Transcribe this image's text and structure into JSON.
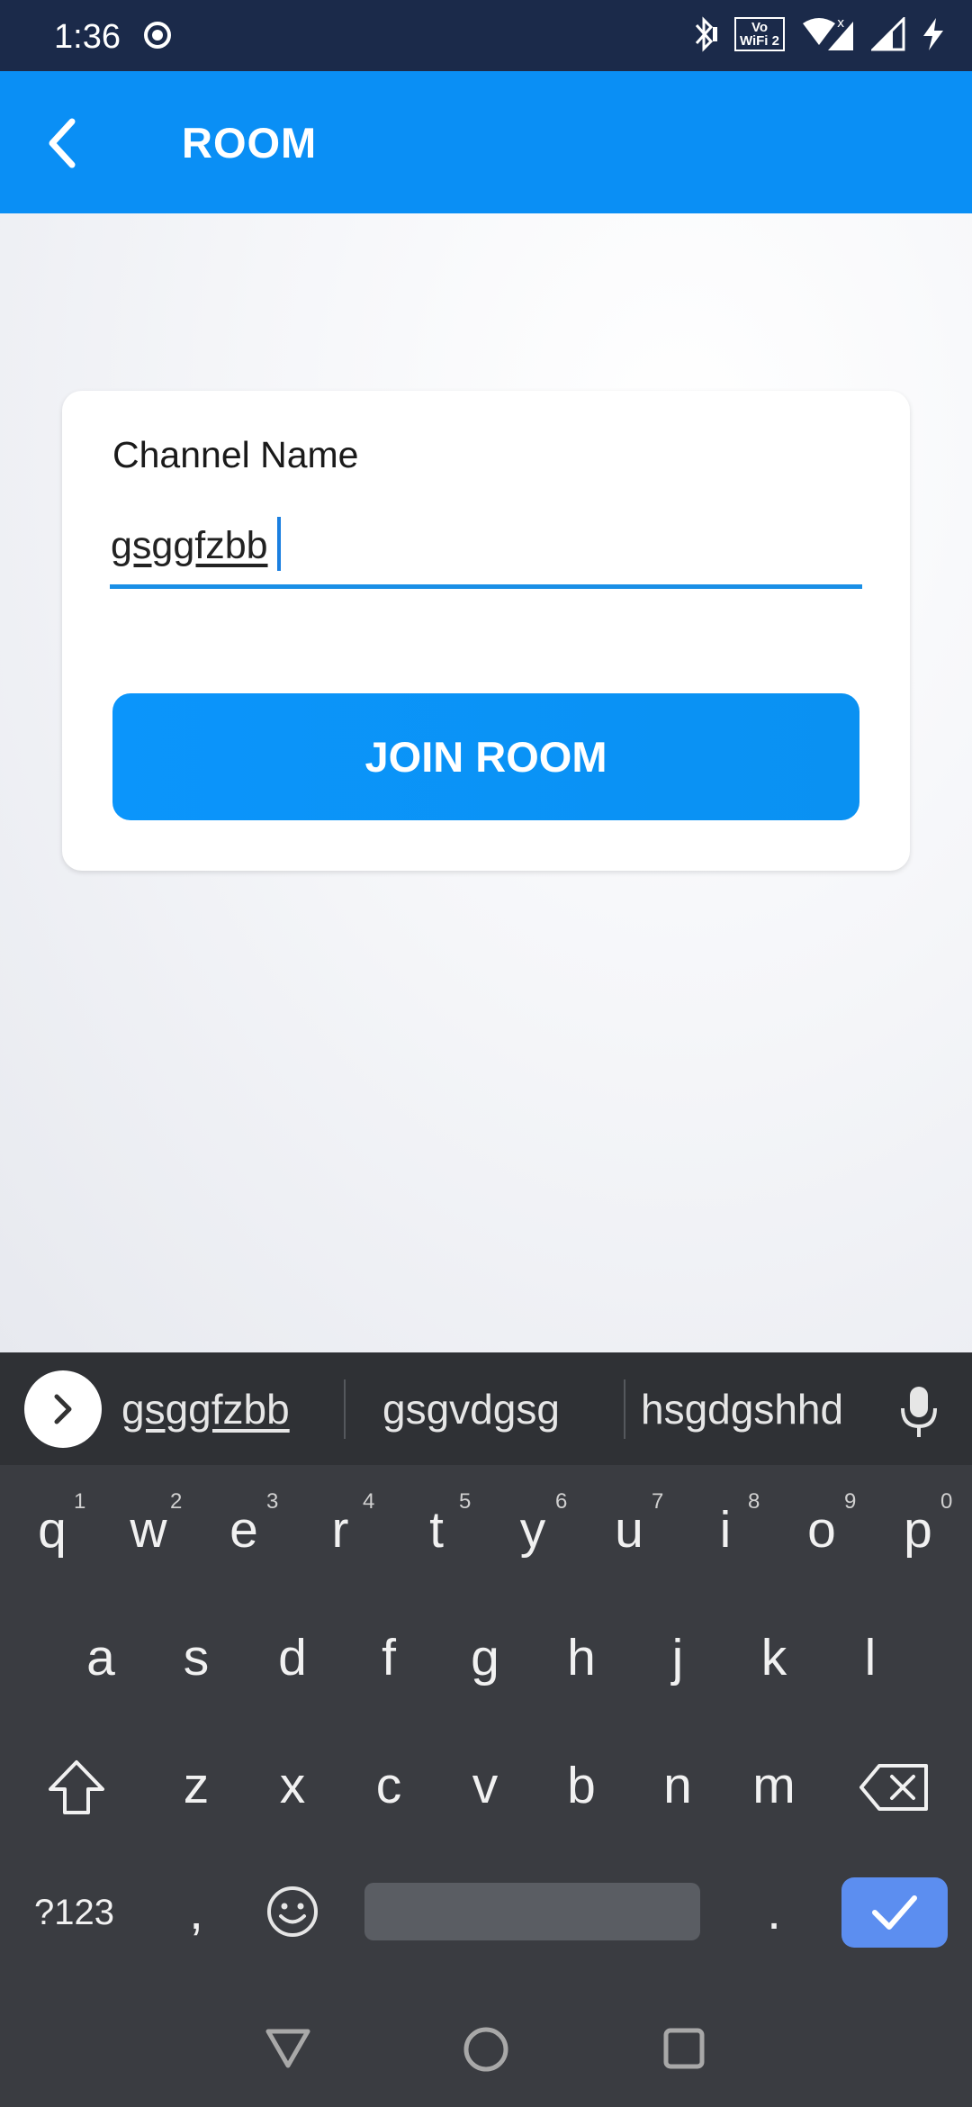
{
  "status_bar": {
    "time": "1:36",
    "vowifi_line1": "Vo",
    "vowifi_line2": "WiFi 2",
    "icons": [
      "record-icon",
      "bluetooth-icon",
      "vowifi-icon",
      "wifi-icon",
      "signal-icon",
      "signal-icon",
      "charging-icon"
    ]
  },
  "app_bar": {
    "title": "ROOM",
    "back_icon": "chevron-left-icon",
    "color": "#0a8ff5"
  },
  "form": {
    "label": "Channel Name",
    "value": "gsggfzbb",
    "button_label": "JOIN ROOM",
    "accent": "#0b95fb"
  },
  "keyboard": {
    "suggestions": [
      "gsggfzbb",
      "gsgvdgsg",
      "hsgdgshhd"
    ],
    "row1": [
      "q",
      "w",
      "e",
      "r",
      "t",
      "y",
      "u",
      "i",
      "o",
      "p"
    ],
    "row1_hints": [
      "1",
      "2",
      "3",
      "4",
      "5",
      "6",
      "7",
      "8",
      "9",
      "0"
    ],
    "row2": [
      "a",
      "s",
      "d",
      "f",
      "g",
      "h",
      "j",
      "k",
      "l"
    ],
    "row3": [
      "z",
      "x",
      "c",
      "v",
      "b",
      "n",
      "m"
    ],
    "symbols_label": "?123",
    "comma": ",",
    "period": ".",
    "enter_color": "#5c8ef0"
  },
  "nav_bar": {
    "icons": [
      "back-triangle-icon",
      "home-circle-icon",
      "recents-square-icon"
    ]
  }
}
